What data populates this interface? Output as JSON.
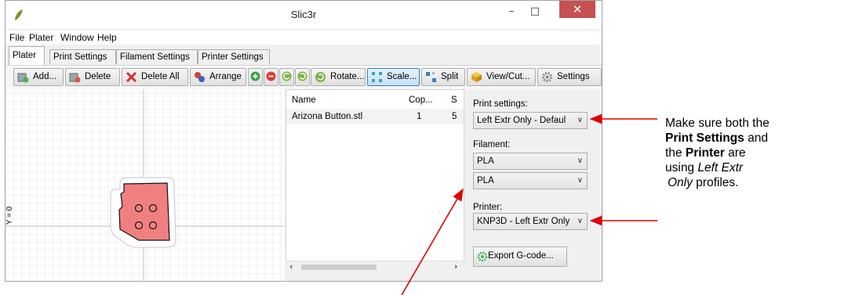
{
  "window": {
    "title": "Slic3r",
    "minimize": "–",
    "maximize": "□",
    "close": "✕"
  },
  "menu": [
    "File",
    "Plater",
    "Window",
    "Help"
  ],
  "tabs": [
    "Plater",
    "Print Settings",
    "Filament Settings",
    "Printer Settings"
  ],
  "toolbar": {
    "add": "Add...",
    "delete": "Delete",
    "delete_all": "Delete All",
    "arrange": "Arrange",
    "rotate": "Rotate...",
    "scale": "Scale...",
    "split": "Split",
    "view_cut": "View/Cut...",
    "settings": "Settings"
  },
  "canvas": {
    "axis_label": "Y = 0"
  },
  "object_list": {
    "columns": [
      "Name",
      "Cop...",
      "S"
    ],
    "rows": [
      {
        "name": "Arizona Button.stl",
        "copies": "1",
        "scale": "5"
      }
    ]
  },
  "side": {
    "print_settings_label": "Print settings:",
    "print_settings_value": "Left Extr Only - Defaul",
    "filament_label": "Filament:",
    "filament_1": "PLA",
    "filament_2": "PLA",
    "printer_label": "Printer:",
    "printer_value": "KNP3D - Left Extr Only",
    "export_button": "Export G-code..."
  },
  "annotation": {
    "line1": "Make sure both the",
    "line2_bold": "Print Settings",
    "line2_rest": " and",
    "line3_pre": "the ",
    "line3_bold": "Printer",
    "line3_rest": " are",
    "line4_pre": "using ",
    "line4_italic": "Left Extr",
    "line5_italic": "Only",
    "line5_rest": " profiles."
  },
  "colors": {
    "arrow": "#e00000",
    "part_fill": "#f08080",
    "close_button": "#c75050"
  }
}
